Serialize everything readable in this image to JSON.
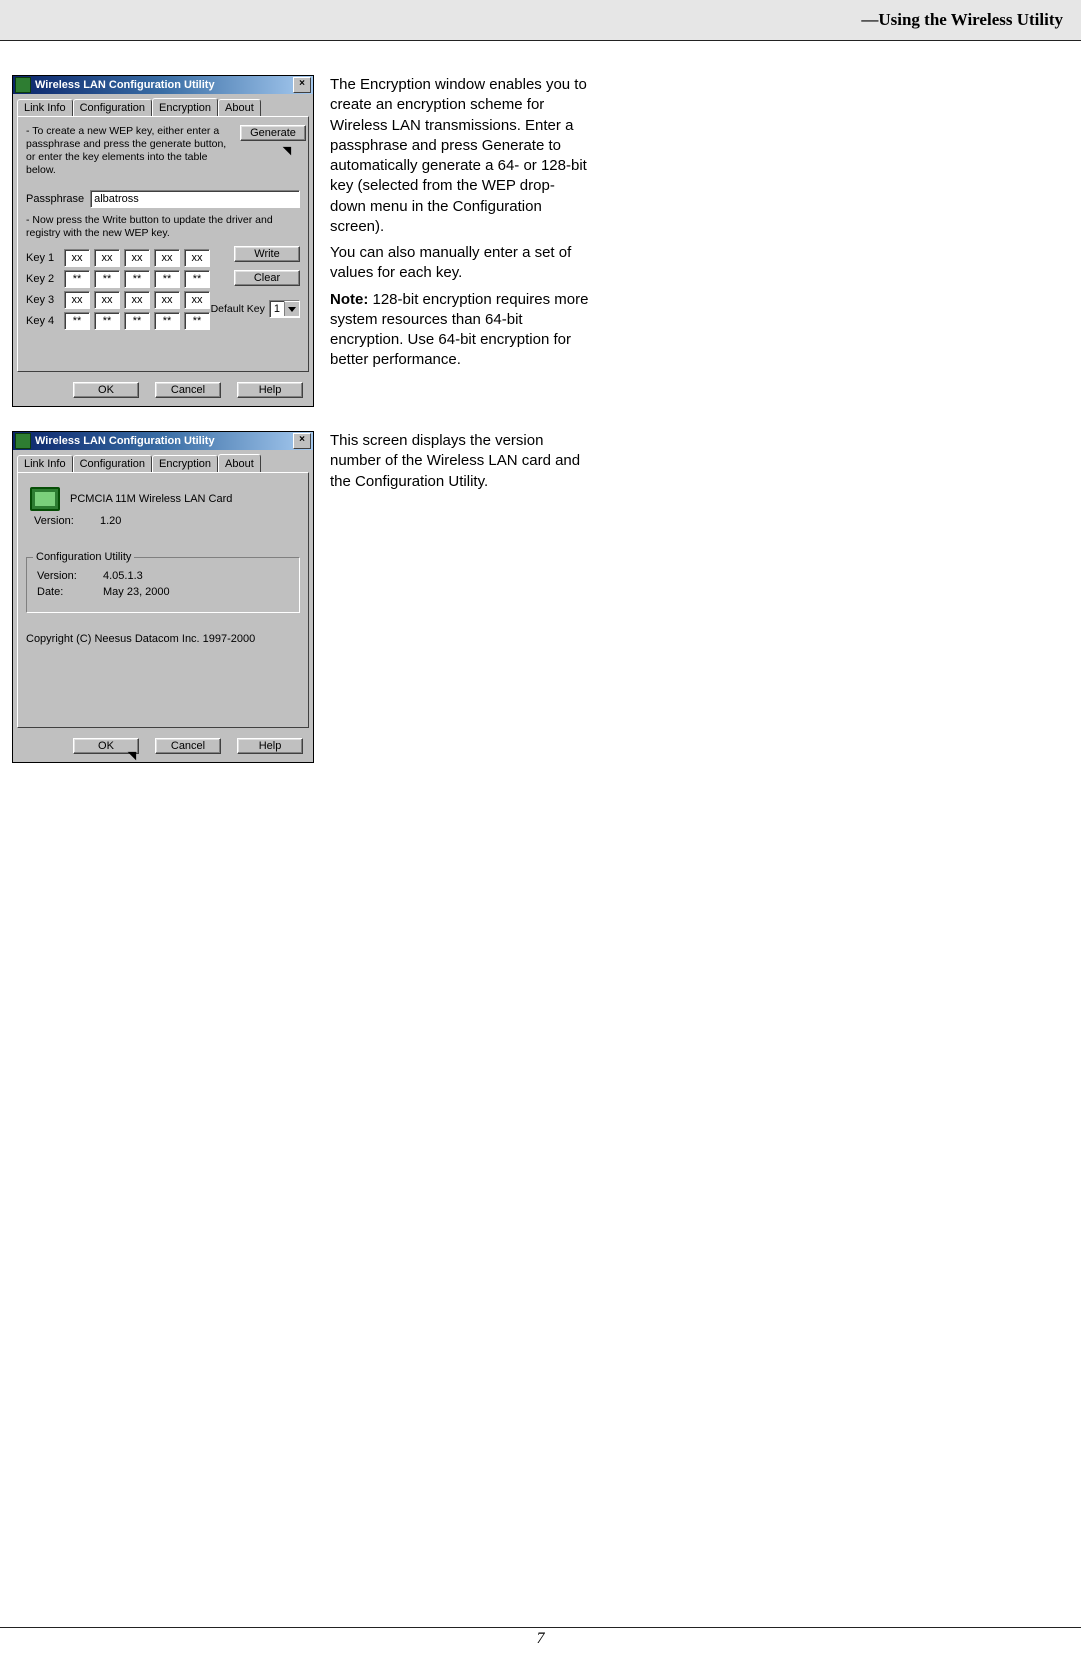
{
  "header": {
    "title": "—Using the Wireless Utility"
  },
  "footer": {
    "page_number": "7"
  },
  "windows": {
    "encryption": {
      "title": "Wireless LAN Configuration Utility",
      "tabs": [
        "Link Info",
        "Configuration",
        "Encryption",
        "About"
      ],
      "active_tab_index": 2,
      "instruction_top": "- To create a new WEP key, either enter a passphrase and press the generate button, or enter the key elements into the table below.",
      "generate_label": "Generate",
      "passphrase_label": "Passphrase",
      "passphrase_value": "albatross",
      "instruction_mid": "- Now press the Write button to update the driver and registry with the new WEP key.",
      "keys": [
        {
          "label": "Key 1",
          "cells": [
            "xx",
            "xx",
            "xx",
            "xx",
            "xx"
          ]
        },
        {
          "label": "Key 2",
          "cells": [
            "**",
            "**",
            "**",
            "**",
            "**"
          ]
        },
        {
          "label": "Key 3",
          "cells": [
            "xx",
            "xx",
            "xx",
            "xx",
            "xx"
          ]
        },
        {
          "label": "Key 4",
          "cells": [
            "**",
            "**",
            "**",
            "**",
            "**"
          ]
        }
      ],
      "write_label": "Write",
      "clear_label": "Clear",
      "default_key_label": "Default Key",
      "default_key_value": "1",
      "bottom": {
        "ok": "OK",
        "cancel": "Cancel",
        "help": "Help"
      }
    },
    "about": {
      "title": "Wireless LAN Configuration Utility",
      "tabs": [
        "Link Info",
        "Configuration",
        "Encryption",
        "About"
      ],
      "active_tab_index": 3,
      "card_name": "PCMCIA 11M Wireless LAN Card",
      "version_label": "Version:",
      "card_version": "1.20",
      "group_title": "Configuration Utility",
      "util_version_label": "Version:",
      "util_version": "4.05.1.3",
      "util_date_label": "Date:",
      "util_date": "May 23, 2000",
      "copyright": "Copyright (C) Neesus Datacom Inc. 1997-2000",
      "bottom": {
        "ok": "OK",
        "cancel": "Cancel",
        "help": "Help"
      }
    }
  },
  "descriptions": {
    "encryption": {
      "p1": "The Encryption window enables you to create an encryption scheme for Wireless LAN transmissions. Enter a passphrase and press Generate to automatically generate a 64- or 128-bit key (selected from the WEP drop-down menu in the Configuration screen).",
      "p2": "You can also manually enter a set of values for each key.",
      "note_label": "Note:",
      "note_text": " 128-bit encryption requires more system resources than 64-bit encryption. Use 64-bit encryption for better performance."
    },
    "about": {
      "p1": "This screen displays the version number of the Wireless LAN card and the Configuration Utility."
    }
  }
}
